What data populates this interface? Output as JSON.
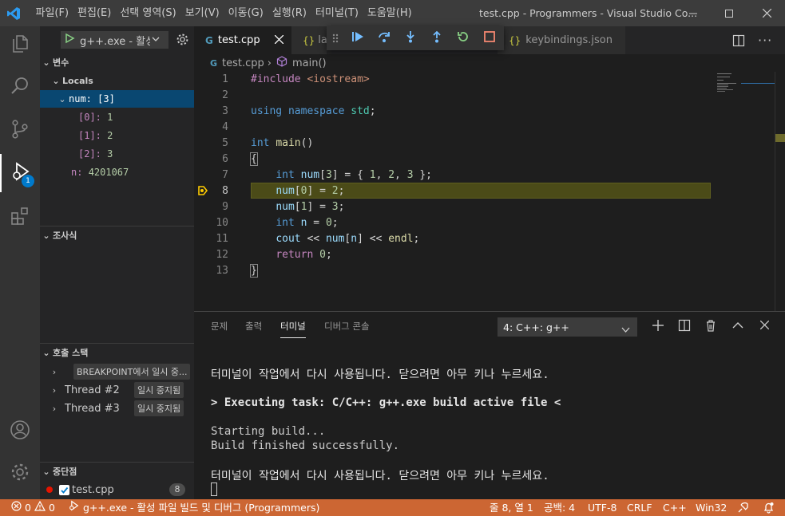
{
  "titlebar": {
    "menu": [
      "파일(F)",
      "편집(E)",
      "선택 영역(S)",
      "보기(V)",
      "이동(G)",
      "실행(R)",
      "터미널(T)",
      "도움말(H)"
    ],
    "window_title": "test.cpp - Programmers - Visual Studio Co..."
  },
  "activity": {
    "debug_badge": "1"
  },
  "sidebar": {
    "run_config": "g++.exe - 활성",
    "variables_title": "변수",
    "locals_label": "Locals",
    "vars": {
      "num_label": "num: [3]",
      "items": [
        {
          "name": "[0]:",
          "value": "1"
        },
        {
          "name": "[1]:",
          "value": "2"
        },
        {
          "name": "[2]:",
          "value": "3"
        }
      ],
      "n_name": "n:",
      "n_value": "4201067"
    },
    "watch_title": "조사식",
    "callstack_title": "호출 스택",
    "threads": [
      {
        "label": "",
        "badge": "BREAKPOINT에서 일시 중..."
      },
      {
        "label": "Thread #2",
        "badge": "일시 중지됨"
      },
      {
        "label": "Thread #3",
        "badge": "일시 중지됨"
      }
    ],
    "breakpoints_title": "중단점",
    "breakpoint_file": "test.cpp",
    "breakpoint_count": "8"
  },
  "editor": {
    "tabs": [
      "test.cpp",
      "la",
      "keybindings.json"
    ],
    "breadcrumb_file": "test.cpp",
    "breadcrumb_symbol": "main()",
    "line_numbers": [
      "1",
      "2",
      "3",
      "4",
      "5",
      "6",
      "7",
      "8",
      "9",
      "10",
      "11",
      "12",
      "13"
    ],
    "current_line": 8
  },
  "panel": {
    "tabs": [
      "문제",
      "출력",
      "터미널",
      "디버그 콘솔"
    ],
    "active_tab": "터미널",
    "terminal_select": "4: C++: g++",
    "lines": [
      "터미널이 작업에서 다시 사용됩니다. 닫으려면 아무 키나 누르세요.",
      "> Executing task: C/C++: g++.exe build active file <",
      "Starting build...",
      "Build finished successfully.",
      "터미널이 작업에서 다시 사용됩니다. 닫으려면 아무 키나 누르세요."
    ]
  },
  "statusbar": {
    "errors": "0",
    "warnings": "0",
    "debug_label": "g++.exe - 활성 파일 빌드 및 디버그 (Programmers)",
    "position": "줄 8, 열 1",
    "spaces": "공백: 4",
    "encoding": "UTF-8",
    "eol": "CRLF",
    "language": "C++",
    "platform": "Win32"
  },
  "colors": {
    "status_bg": "#cc6633",
    "accent_blue": "#007acc",
    "line_highlight": "#4b4b18",
    "breakpoint_arrow": "#ffcc00"
  }
}
